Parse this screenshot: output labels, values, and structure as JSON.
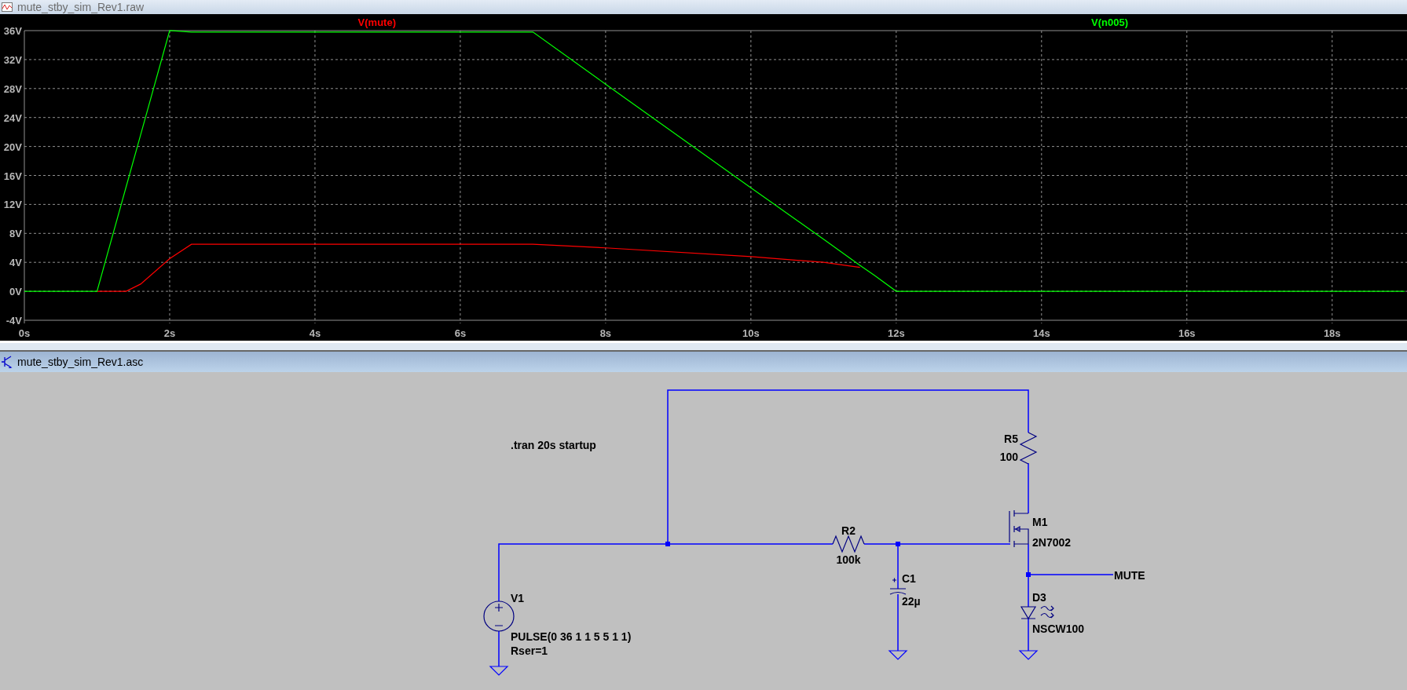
{
  "waveform_window": {
    "title": "mute_stby_sim_Rev1.raw",
    "chart_data": {
      "type": "line",
      "x": [
        0,
        1,
        1.4,
        1.6,
        2,
        2.3,
        7,
        8,
        10,
        11,
        11.5,
        11.7,
        12,
        19
      ],
      "series": [
        {
          "name": "V(mute)",
          "color": "#ff0000",
          "values": [
            null,
            0,
            0,
            1,
            4.5,
            6.5,
            6.5,
            6,
            4.8,
            4,
            3.3,
            null,
            null,
            null
          ]
        },
        {
          "name": "V(n005)",
          "color": "#00ff00",
          "values": [
            0,
            0,
            14.4,
            21.6,
            36,
            35.8,
            35.8,
            28.6,
            14.3,
            7.2,
            3.6,
            2.2,
            0,
            0
          ]
        }
      ],
      "grid": true,
      "xlim": [
        0,
        19.03
      ],
      "ylim": [
        -4,
        36
      ],
      "xticks": [
        {
          "value": 0,
          "label": "0s"
        },
        {
          "value": 2,
          "label": "2s"
        },
        {
          "value": 4,
          "label": "4s"
        },
        {
          "value": 6,
          "label": "6s"
        },
        {
          "value": 8,
          "label": "8s"
        },
        {
          "value": 10,
          "label": "10s"
        },
        {
          "value": 12,
          "label": "12s"
        },
        {
          "value": 14,
          "label": "14s"
        },
        {
          "value": 16,
          "label": "16s"
        },
        {
          "value": 18,
          "label": "18s"
        }
      ],
      "yticks": [
        {
          "value": -4,
          "label": "-4V"
        },
        {
          "value": 0,
          "label": "0V"
        },
        {
          "value": 4,
          "label": "4V"
        },
        {
          "value": 8,
          "label": "8V"
        },
        {
          "value": 12,
          "label": "12V"
        },
        {
          "value": 16,
          "label": "16V"
        },
        {
          "value": 20,
          "label": "20V"
        },
        {
          "value": 24,
          "label": "24V"
        },
        {
          "value": 28,
          "label": "28V"
        },
        {
          "value": 32,
          "label": "32V"
        },
        {
          "value": 36,
          "label": "36V"
        }
      ]
    }
  },
  "schematic_window": {
    "title": "mute_stby_sim_Rev1.asc",
    "directive": ".tran 20s startup",
    "components": [
      {
        "kind": "voltage_source",
        "ref": "V1",
        "value": "PULSE(0 36 1 1 5 5 1 1)",
        "extra": "Rser=1"
      },
      {
        "kind": "resistor",
        "ref": "R2",
        "value": "100k"
      },
      {
        "kind": "capacitor",
        "ref": "C1",
        "value": "22µ"
      },
      {
        "kind": "resistor",
        "ref": "R5",
        "value": "100"
      },
      {
        "kind": "nmos",
        "ref": "M1",
        "value": "2N7002"
      },
      {
        "kind": "led",
        "ref": "D3",
        "value": "NSCW100"
      }
    ],
    "net_labels": [
      "MUTE"
    ]
  }
}
